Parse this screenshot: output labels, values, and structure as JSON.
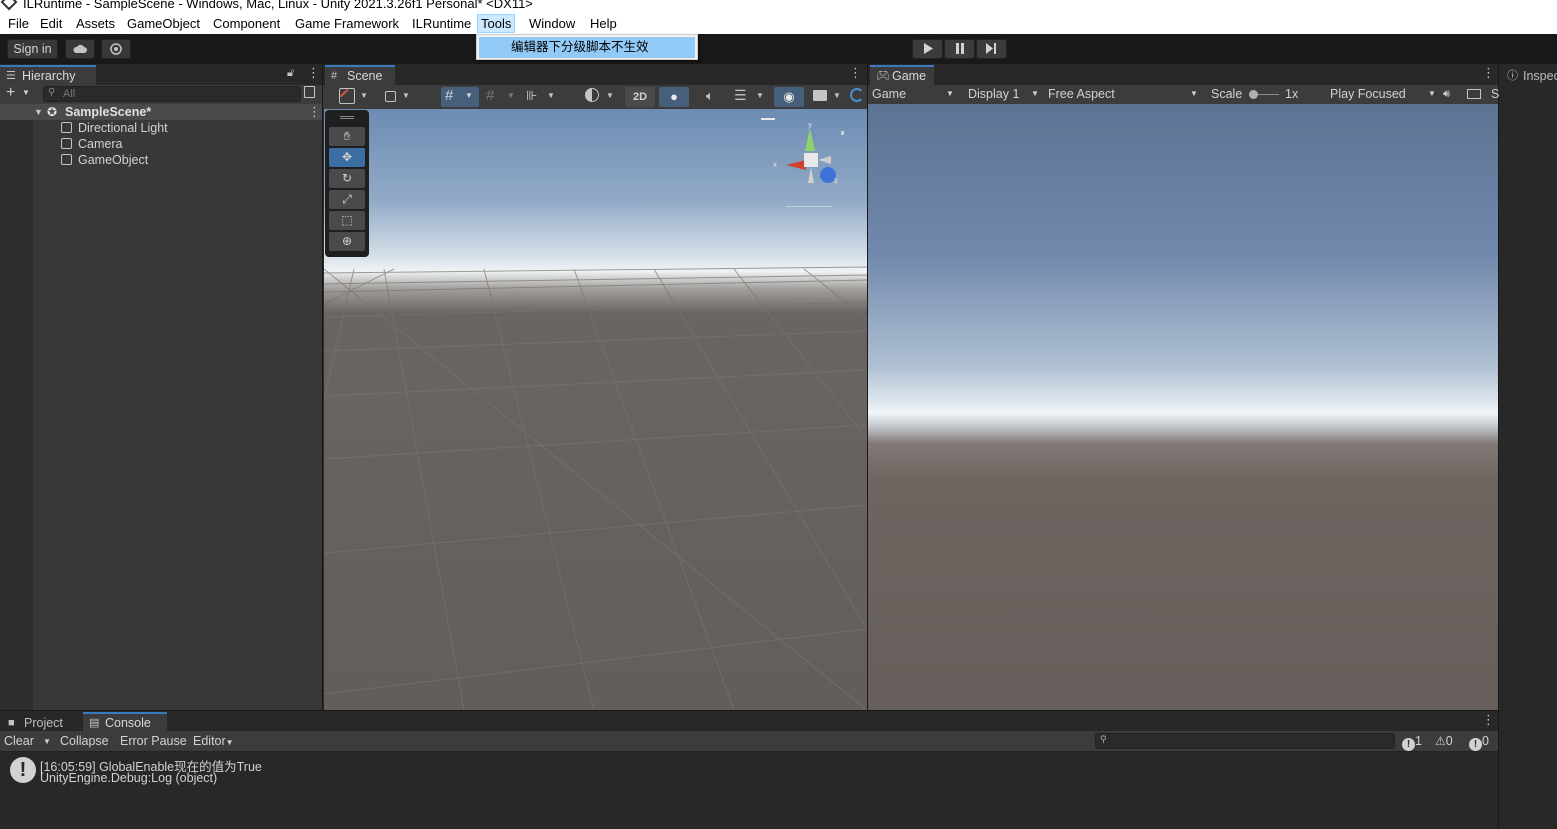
{
  "window": {
    "title": "ILRuntime - SampleScene - Windows, Mac, Linux - Unity 2021.3.26f1 Personal* <DX11>"
  },
  "menubar": {
    "items": [
      "File",
      "Edit",
      "Assets",
      "GameObject",
      "Component",
      "Game Framework",
      "ILRuntime",
      "Tools",
      "Window",
      "Help"
    ],
    "active": "Tools"
  },
  "tools_menu": {
    "items": [
      "编辑器下分级脚本不生效"
    ]
  },
  "toolbar": {
    "sign_in": "Sign in"
  },
  "hierarchy": {
    "tab": "Hierarchy",
    "search_placeholder": "All",
    "scene": "SampleScene*",
    "objects": [
      "Directional Light",
      "Camera",
      "GameObject"
    ]
  },
  "scene": {
    "tab": "Scene",
    "btn_2d": "2D",
    "gizmo": {
      "x": "x",
      "y": "y",
      "z": "z"
    }
  },
  "game": {
    "tab": "Game",
    "view_select": "Game",
    "display_select": "Display 1",
    "aspect_select": "Free Aspect",
    "scale_label": "Scale",
    "scale_value": "1x",
    "play_mode": "Play Focused",
    "trailing": "S"
  },
  "inspector": {
    "tab": "Inspec"
  },
  "console": {
    "tabs": [
      "Project",
      "Console"
    ],
    "active_tab": "Console",
    "toolbar": {
      "clear": "Clear",
      "collapse": "Collapse",
      "error_pause": "Error Pause",
      "editor": "Editor"
    },
    "counts": {
      "log": "1",
      "warn": "0",
      "error": "0"
    },
    "entries": [
      {
        "line1": "[16:05:59] GlobalEnable现在的值为True",
        "line2": "UnityEngine.Debug:Log (object)"
      }
    ]
  },
  "colors": {
    "accent": "#3a79bb",
    "menu_highlight": "#91c9f7",
    "panel_bg": "#383838",
    "dark_bg": "#191919"
  }
}
